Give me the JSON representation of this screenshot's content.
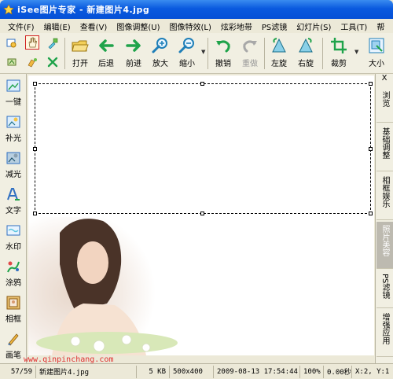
{
  "window": {
    "title": "iSee图片专家 - 新建图片4.jpg"
  },
  "menu": [
    "文件(F)",
    "编辑(E)",
    "查看(V)",
    "图像调整(U)",
    "图像特效(L)",
    "炫彩地带",
    "PS滤镜",
    "幻灯片(S)",
    "工具(T)",
    "帮"
  ],
  "toolbar": {
    "open": "打开",
    "back": "后退",
    "forward": "前进",
    "zoom_in": "放大",
    "zoom_out": "缩小",
    "undo": "撤销",
    "redo": "重做",
    "rotate_left": "左旋",
    "rotate_right": "右旋",
    "crop": "裁剪",
    "resize": "大小"
  },
  "left_tools": [
    "一键",
    "补光",
    "减光",
    "文字",
    "水印",
    "涂鸦",
    "相框",
    "画笔"
  ],
  "right_tabs": {
    "close": "X",
    "tabs": [
      {
        "label": "浏览",
        "active": false
      },
      {
        "label": "基础调整",
        "active": false
      },
      {
        "label": "相框娱乐",
        "active": false
      },
      {
        "label": "照片美容",
        "active": true
      },
      {
        "label": "PS滤镜",
        "active": false
      },
      {
        "label": "增强应用",
        "active": false
      }
    ]
  },
  "watermark": "www.qinpinchang.com",
  "status": {
    "index": "57/59",
    "filename": "新建图片4.jpg",
    "filesize": "5 KB",
    "dimensions": "500x400",
    "datetime": "2009-08-13 17:54:44",
    "zoom": "100%",
    "time": "0.00秒",
    "coords": "X:2, Y:1"
  },
  "colors": {
    "title_bar": "#0a5adf",
    "accent_green": "#1fa34a",
    "red_marker": "#d02020"
  }
}
